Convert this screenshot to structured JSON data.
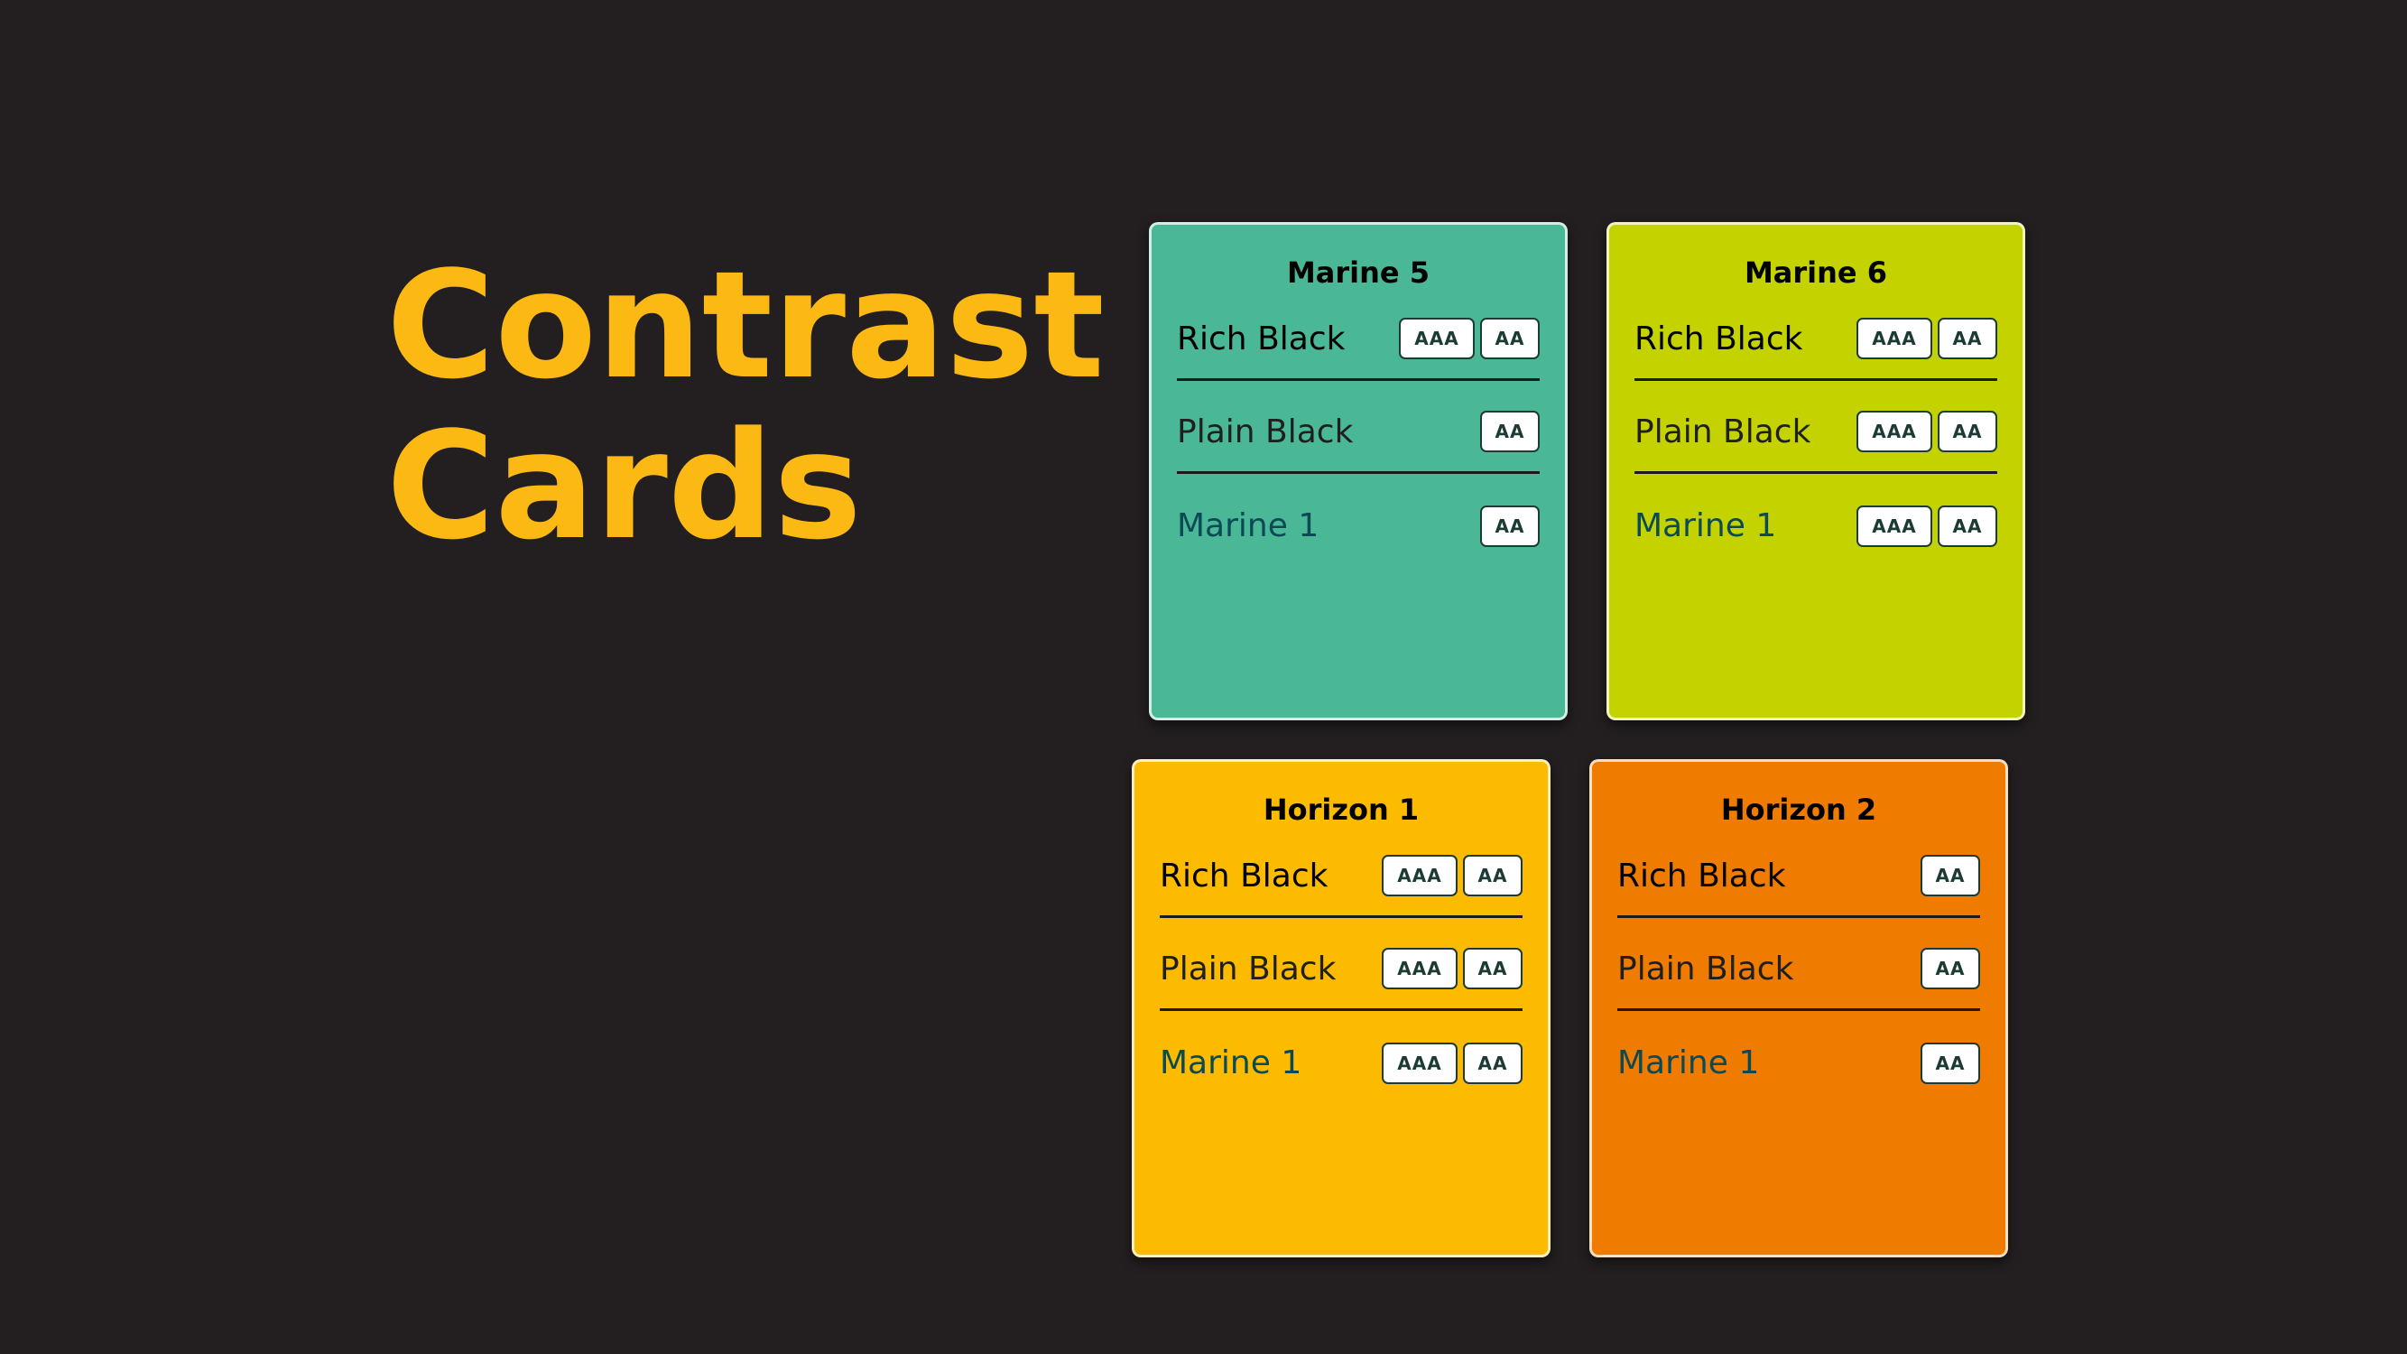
{
  "title": {
    "line1": "Contrast",
    "line2": "Cards"
  },
  "colors": {
    "background": "#231f20",
    "title": "#fdb913",
    "rich_black": "#000000",
    "plain_black": "#1f1f1f",
    "marine_1": "#0b4a55"
  },
  "cards": [
    {
      "name": "Marine 5",
      "background": "#4ab896",
      "rows": [
        {
          "label": "Rich Black",
          "badges": [
            "AAA",
            "AA"
          ]
        },
        {
          "label": "Plain Black",
          "badges": [
            "AA"
          ]
        },
        {
          "label": "Marine 1",
          "badges": [
            "AA"
          ]
        }
      ]
    },
    {
      "name": "Marine 6",
      "background": "#c4d300",
      "rows": [
        {
          "label": "Rich Black",
          "badges": [
            "AAA",
            "AA"
          ]
        },
        {
          "label": "Plain Black",
          "badges": [
            "AAA",
            "AA"
          ]
        },
        {
          "label": "Marine 1",
          "badges": [
            "AAA",
            "AA"
          ]
        }
      ]
    },
    {
      "name": "Horizon 1",
      "background": "#fdbb00",
      "rows": [
        {
          "label": "Rich Black",
          "badges": [
            "AAA",
            "AA"
          ]
        },
        {
          "label": "Plain Black",
          "badges": [
            "AAA",
            "AA"
          ]
        },
        {
          "label": "Marine 1",
          "badges": [
            "AAA",
            "AA"
          ]
        }
      ]
    },
    {
      "name": "Horizon 2",
      "background": "#ef7b00",
      "rows": [
        {
          "label": "Rich Black",
          "badges": [
            "AA"
          ]
        },
        {
          "label": "Plain Black",
          "badges": [
            "AA"
          ]
        },
        {
          "label": "Marine 1",
          "badges": [
            "AA"
          ]
        }
      ]
    }
  ]
}
